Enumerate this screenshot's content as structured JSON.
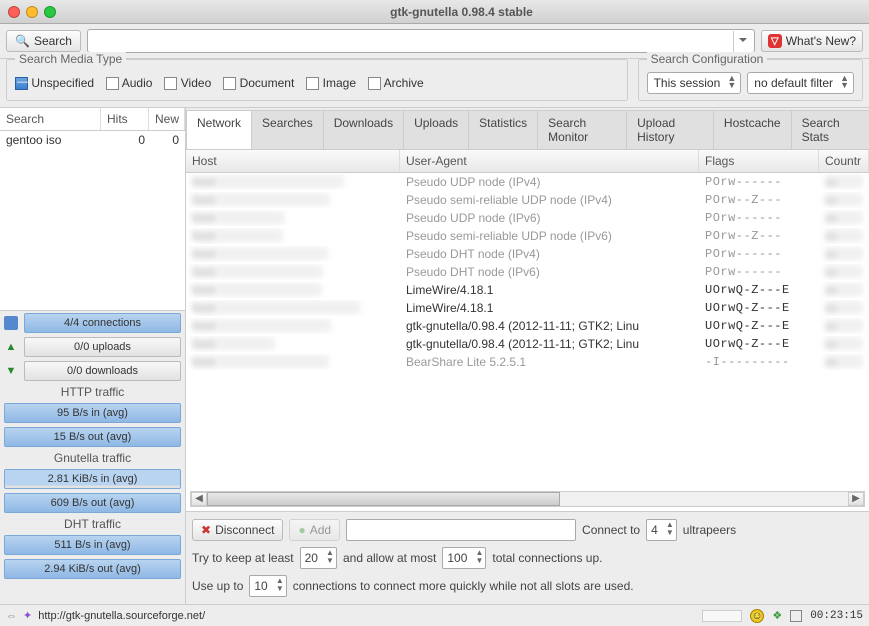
{
  "window": {
    "title": "gtk-gnutella 0.98.4 stable"
  },
  "toolbar": {
    "search_label": "Search",
    "whatsnew_label": "What's New?"
  },
  "media_type": {
    "group_label": "Search Media Type",
    "unspecified": "Unspecified",
    "audio": "Audio",
    "video": "Video",
    "document": "Document",
    "image": "Image",
    "archive": "Archive"
  },
  "search_config": {
    "group_label": "Search Configuration",
    "session": "This session",
    "filter": "no default filter"
  },
  "sidebar": {
    "headers": {
      "search": "Search",
      "hits": "Hits",
      "new": "New"
    },
    "rows": [
      {
        "name": "gentoo iso",
        "hits": "0",
        "new": "0"
      }
    ],
    "conn_label": "4/4 connections",
    "up_label": "0/0 uploads",
    "dn_label": "0/0 downloads",
    "http_label": "HTTP traffic",
    "http_in": "95 B/s in (avg)",
    "http_out": "15 B/s out (avg)",
    "gnutella_label": "Gnutella traffic",
    "gnutella_in": "2.81 KiB/s in (avg)",
    "gnutella_out": "609 B/s out (avg)",
    "dht_label": "DHT traffic",
    "dht_in": "511 B/s in (avg)",
    "dht_out": "2.94 KiB/s out (avg)"
  },
  "tabs": {
    "network": "Network",
    "searches": "Searches",
    "downloads": "Downloads",
    "uploads": "Uploads",
    "statistics": "Statistics",
    "monitor": "Search Monitor",
    "history": "Upload History",
    "hostcache": "Hostcache",
    "stats": "Search Stats"
  },
  "table": {
    "headers": {
      "host": "Host",
      "ua": "User-Agent",
      "flags": "Flags",
      "country": "Countr"
    },
    "rows": [
      {
        "dim": true,
        "ua": "Pseudo UDP node (IPv4)",
        "flags": "POrw------"
      },
      {
        "dim": true,
        "ua": "Pseudo semi-reliable UDP node (IPv4)",
        "flags": "POrw--Z---"
      },
      {
        "dim": true,
        "ua": "Pseudo UDP node (IPv6)",
        "flags": "POrw------"
      },
      {
        "dim": true,
        "ua": "Pseudo semi-reliable UDP node (IPv6)",
        "flags": "POrw--Z---"
      },
      {
        "dim": true,
        "ua": "Pseudo DHT node (IPv4)",
        "flags": "POrw------"
      },
      {
        "dim": true,
        "ua": "Pseudo DHT node (IPv6)",
        "flags": "POrw------"
      },
      {
        "dim": false,
        "ua": "LimeWire/4.18.1",
        "flags": "UOrwQ-Z---E"
      },
      {
        "dim": false,
        "ua": "LimeWire/4.18.1",
        "flags": "UOrwQ-Z---E"
      },
      {
        "dim": false,
        "ua": "gtk-gnutella/0.98.4 (2012-11-11; GTK2; Linu",
        "flags": "UOrwQ-Z---E"
      },
      {
        "dim": false,
        "ua": "gtk-gnutella/0.98.4 (2012-11-11; GTK2; Linu",
        "flags": "UOrwQ-Z---E"
      },
      {
        "dim": true,
        "ua": "BearShare Lite 5.2.5.1",
        "flags": "-I---------"
      }
    ]
  },
  "controls": {
    "disconnect": "Disconnect",
    "add": "Add",
    "connect_to": "Connect to",
    "ultrapeers": "ultrapeers",
    "connect_count": "4",
    "keep_prefix": "Try to keep at least",
    "keep_val": "20",
    "allow_mid": "and allow at most",
    "allow_val": "100",
    "allow_suffix": "total connections up.",
    "useup_prefix": "Use up to",
    "useup_val": "10",
    "useup_suffix": "connections to connect more quickly while not all slots are used."
  },
  "status": {
    "url": "http://gtk-gnutella.sourceforge.net/",
    "clock": "00:23:15"
  }
}
